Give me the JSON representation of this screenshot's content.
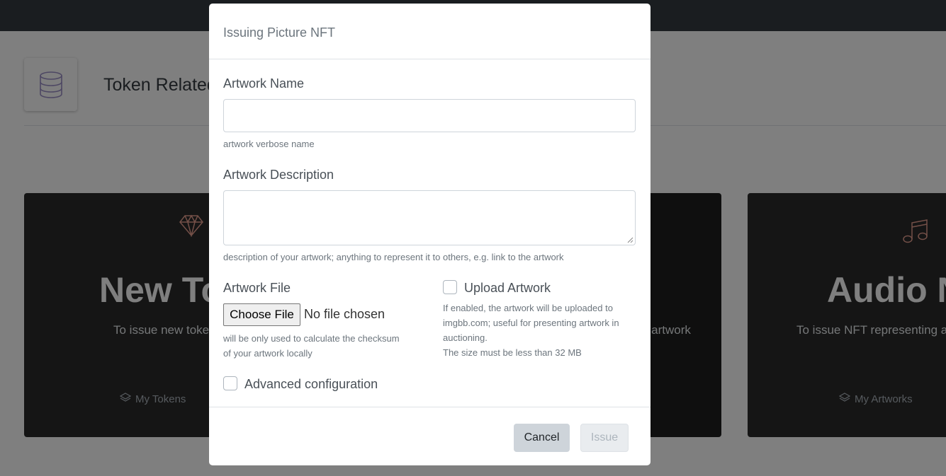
{
  "background": {
    "header": {
      "title": "Token Related"
    },
    "cards": [
      {
        "title": "New To",
        "description": "To issue new toke",
        "link": "My Tokens",
        "icon": "diamond-icon"
      },
      {
        "description": "e artwork",
        "icon": "none"
      },
      {
        "title": "Audio N",
        "description": "To issue NFT representing a",
        "link": "My Artworks",
        "icon": "music-note-icon"
      }
    ]
  },
  "modal": {
    "title": "Issuing Picture NFT",
    "artwork_name": {
      "label": "Artwork Name",
      "value": "",
      "help": "artwork verbose name"
    },
    "artwork_description": {
      "label": "Artwork Description",
      "value": "",
      "help": "description of your artwork; anything to represent it to others, e.g. link to the artwork"
    },
    "artwork_file": {
      "label": "Artwork File",
      "button": "Choose File",
      "status": "No file chosen",
      "help_line1": "will be only used to calculate the checksum",
      "help_line2": "of your artwork locally"
    },
    "upload_artwork": {
      "label": "Upload Artwork",
      "checked": false,
      "help_line1": "If enabled, the artwork will be uploaded to",
      "help_line2": "imgbb.com; useful for presenting artwork in",
      "help_line3": "auctioning.",
      "help_line4": "The size must be less than 32 MB"
    },
    "advanced": {
      "label": "Advanced configuration",
      "checked": false
    },
    "footer": {
      "cancel": "Cancel",
      "issue": "Issue"
    }
  },
  "colors": {
    "topbar": "#343a40",
    "card": "#2b2b2b",
    "icon_accent": "#e8a090"
  }
}
